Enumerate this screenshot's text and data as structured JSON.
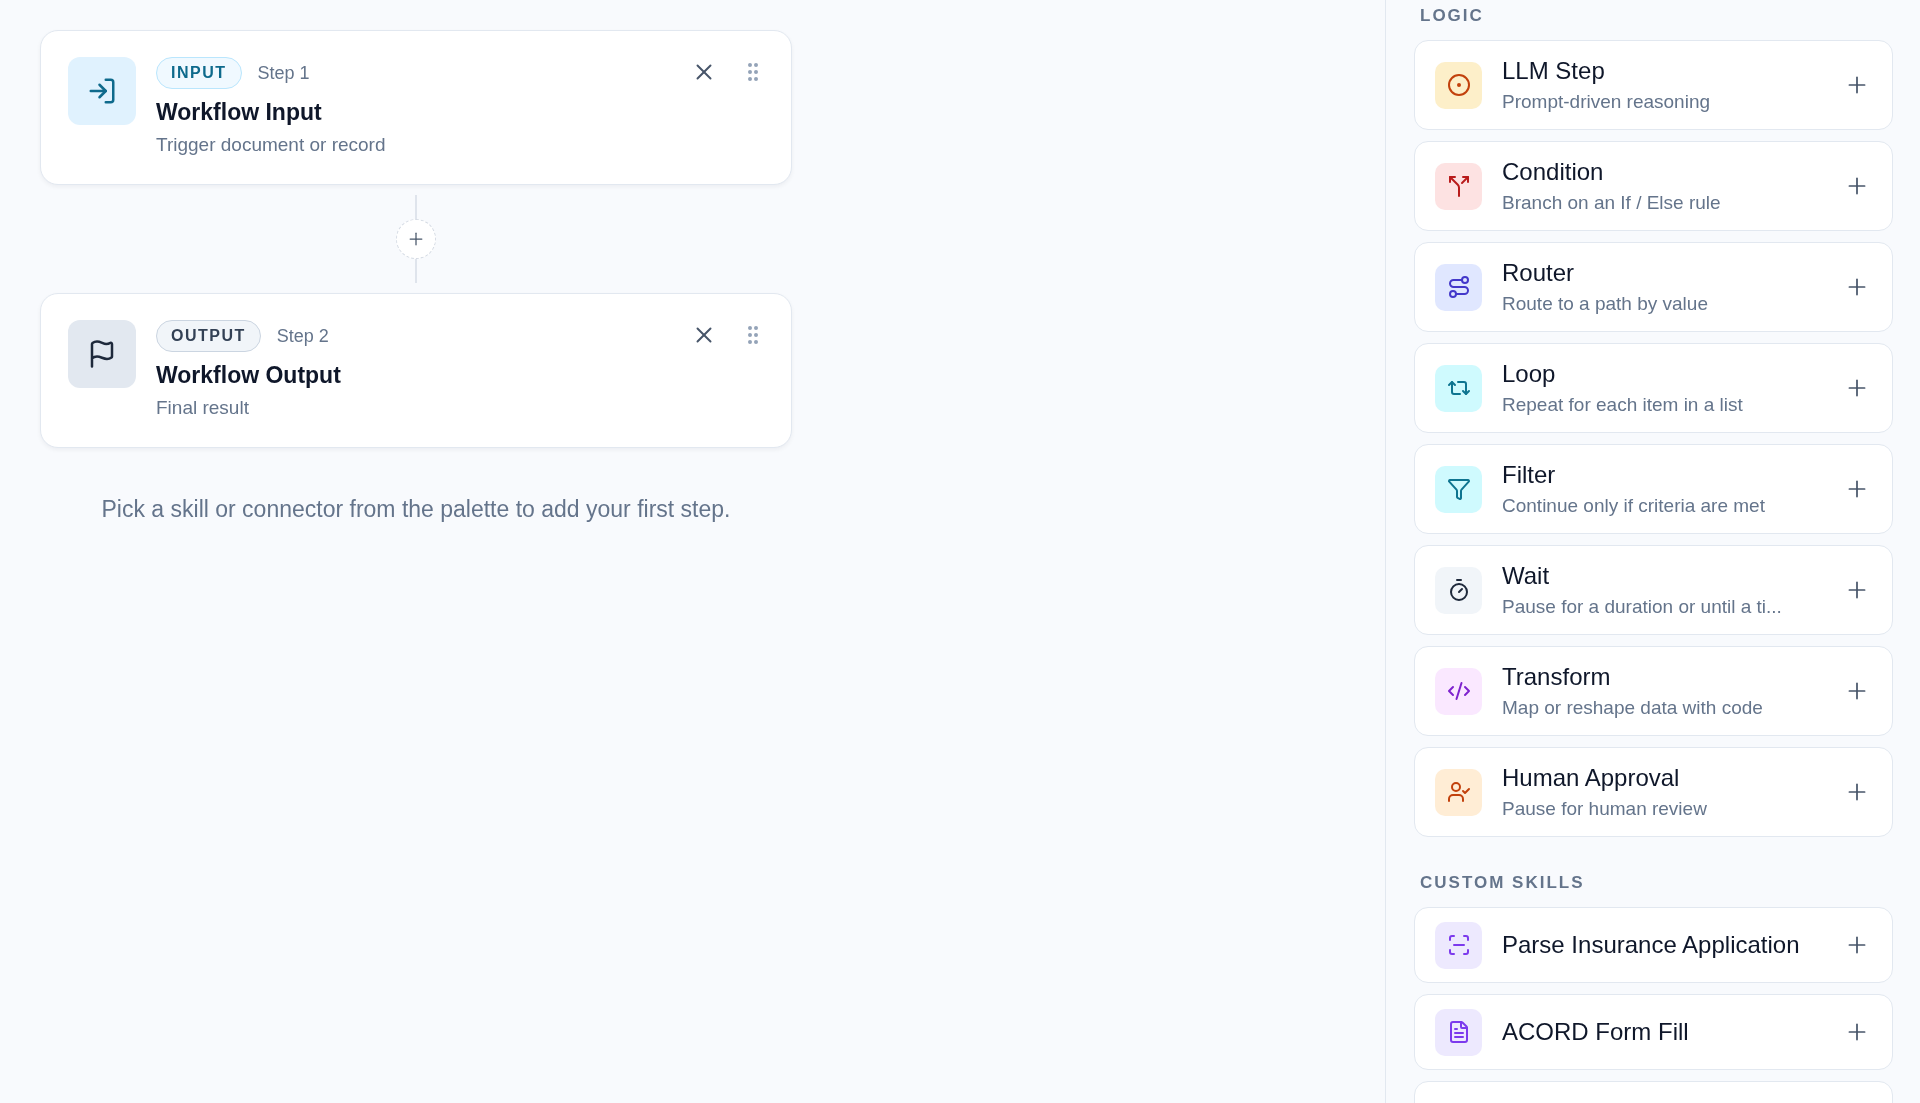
{
  "steps": [
    {
      "kind": "input",
      "badge": "INPUT",
      "step": "Step 1",
      "title": "Workflow Input",
      "subtitle": "Trigger document or record"
    },
    {
      "kind": "output",
      "badge": "OUTPUT",
      "step": "Step 2",
      "title": "Workflow Output",
      "subtitle": "Final result"
    }
  ],
  "hint": "Pick a skill or connector from the palette to add your first step.",
  "palette": [
    {
      "heading": "LOGIC",
      "items": [
        {
          "title": "LLM Step",
          "subtitle": "Prompt-driven reasoning"
        },
        {
          "title": "Condition",
          "subtitle": "Branch on an If / Else rule"
        },
        {
          "title": "Router",
          "subtitle": "Route to a path by value"
        },
        {
          "title": "Loop",
          "subtitle": "Repeat for each item in a list"
        },
        {
          "title": "Filter",
          "subtitle": "Continue only if criteria are met"
        },
        {
          "title": "Wait",
          "subtitle": "Pause for a duration or until a ti..."
        },
        {
          "title": "Transform",
          "subtitle": "Map or reshape data with code"
        },
        {
          "title": "Human Approval",
          "subtitle": "Pause for human review"
        }
      ]
    },
    {
      "heading": "CUSTOM SKILLS",
      "items": [
        {
          "title": "Parse Insurance Application"
        },
        {
          "title": "ACORD Form Fill"
        }
      ]
    }
  ]
}
